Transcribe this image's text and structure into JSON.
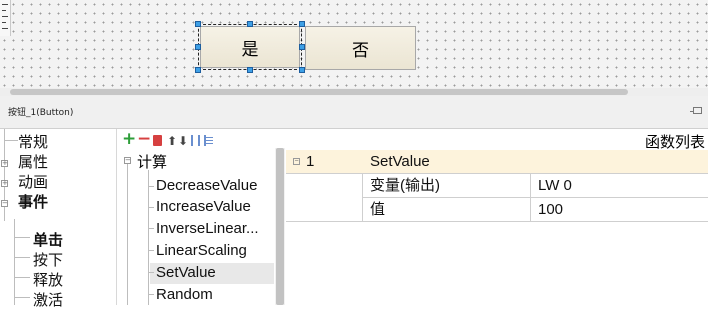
{
  "canvas": {
    "buttons": [
      {
        "label": "是"
      },
      {
        "label": "否"
      }
    ]
  },
  "component_bar": {
    "title": "按钮_1(Button)"
  },
  "events_panel": {
    "categories": [
      {
        "label": "常规",
        "bold": false
      },
      {
        "label": "属性",
        "bold": false
      },
      {
        "label": "动画",
        "bold": false
      },
      {
        "label": "事件",
        "bold": true
      },
      {
        "label": "单击",
        "bold": true
      },
      {
        "label": "按下",
        "bold": false
      },
      {
        "label": "释放",
        "bold": false
      },
      {
        "label": "激活",
        "bold": false
      }
    ]
  },
  "function_panel": {
    "toolbar": {
      "add": "+",
      "remove": "−"
    },
    "header_label": "函数列表",
    "group": "计算",
    "functions": [
      "DecreaseValue",
      "IncreaseValue",
      "InverseLinear...",
      "LinearScaling",
      "SetValue",
      "Random"
    ],
    "selected": "SetValue"
  },
  "grid": {
    "row_index": "1",
    "function_name": "SetValue",
    "params": [
      {
        "name": "变量(输出)",
        "value": "LW 0"
      },
      {
        "name": "值",
        "value": "100"
      }
    ]
  },
  "colors": {
    "accent_toolbar_add": "#2e9e3a",
    "accent_toolbar_remove": "#d64040",
    "grid_header": "#fdf3dc",
    "selection_handle": "#3ea0e6"
  }
}
